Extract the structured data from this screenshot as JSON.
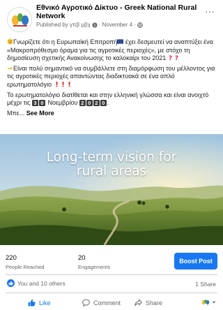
{
  "post": {
    "page_name": "Εθνικό Αγροτικό Δίκτυο - Greek National Rural Network",
    "published_by": "Published by γπβ μβχ",
    "date": "November 4",
    "separator": "·",
    "more_label": "···",
    "paragraph1_a": "Γνωρίζετε ότι η Ευρωπαϊκή Επιτροπή",
    "paragraph1_b": " έχει δεσμευτεί να αναπτύξει ένα «Μακροπρόθεσμο όραμα για τις αγροτικές περιοχές», με στόχο τη δημοσίευση σχετικής Ανακοίνωσης το καλοκαίρι του 2021",
    "paragraph2": "Είναι πολύ σημαντικό να συμβάλλετε στη διαμόρφωση του μέλλοντος για τις αγροτικές περιοχές απαντώντας διαδικτυακά σε ένα απλό ερωτηματολόγιο",
    "paragraph3_a": "Το ερωτηματολόγιο διατίθεται και στην ελληνική γλώσσα και είναι ανοιχτό μέχρι τις",
    "date_digits_day": [
      "3",
      "0"
    ],
    "date_month": " Νοεμβρίου ",
    "date_digits_year": [
      "2",
      "0",
      "2",
      "0"
    ],
    "date_end": ".",
    "truncated_text": "Μπε...",
    "see_more": "See More",
    "image_title_line1": "Long-term vision for",
    "image_title_line2": "rural areas"
  },
  "stats": {
    "reached_value": "220",
    "reached_label": "People Reached",
    "engagements_value": "20",
    "engagements_label": "Engagements",
    "boost_label": "Boost Post"
  },
  "reactions": {
    "text": "You and 10 others",
    "shares": "1 Share"
  },
  "actions": {
    "like": "Like",
    "comment": "Comment",
    "share": "Share"
  },
  "colors": {
    "accent": "#1877f2",
    "secondary_text": "#65676b"
  }
}
